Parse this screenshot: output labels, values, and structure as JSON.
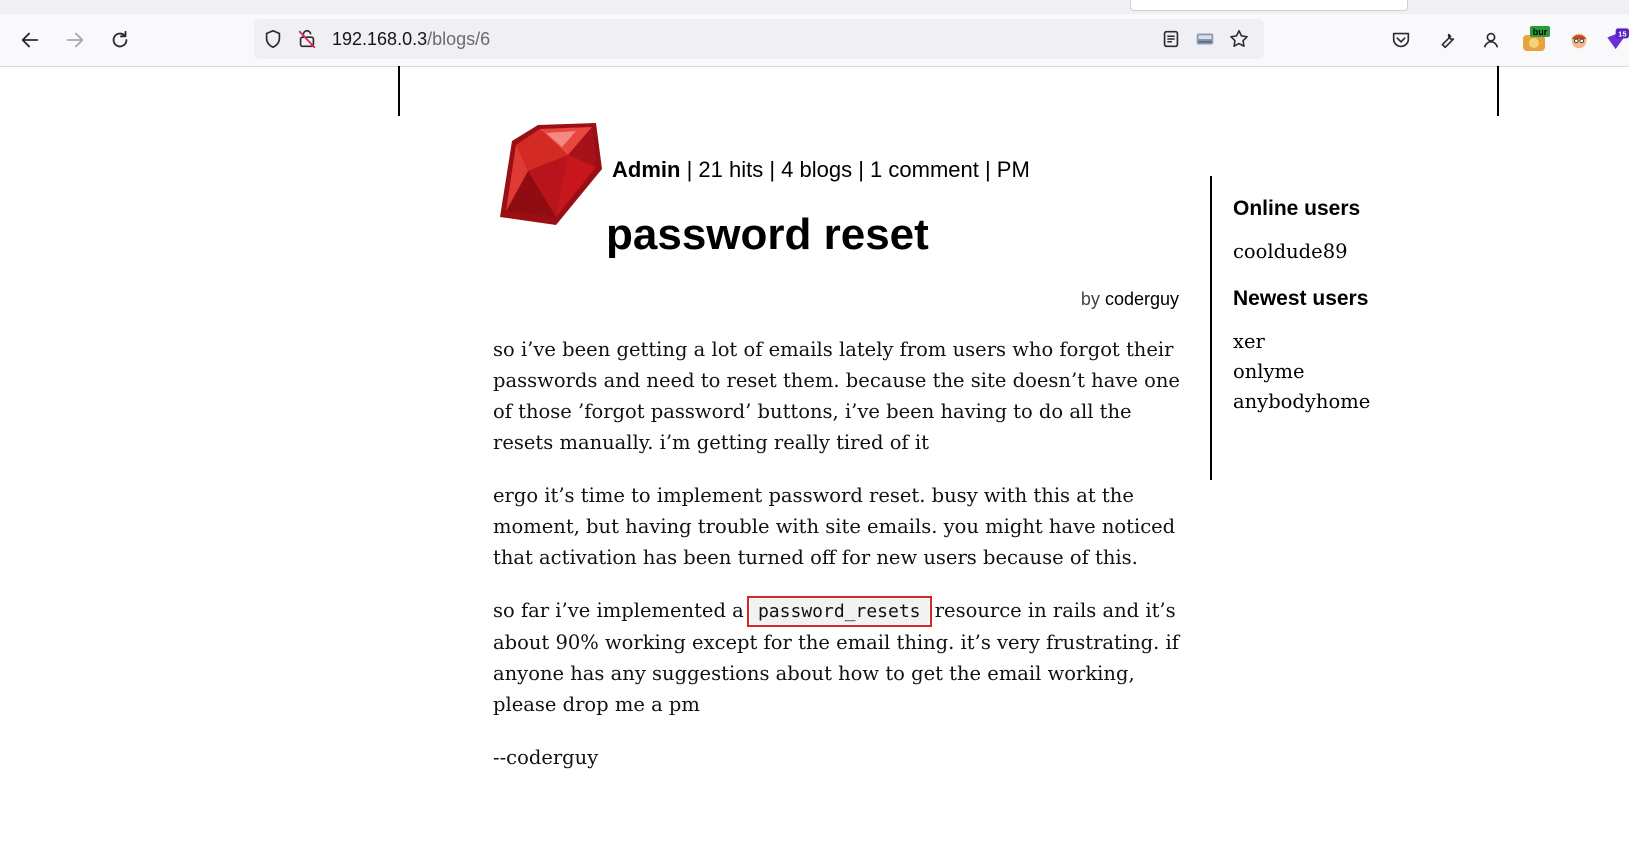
{
  "browser": {
    "url_host": "192.168.0.3",
    "url_path": "/blogs/6",
    "ext_burp_label": "bur",
    "ext_badge_count": "15"
  },
  "post": {
    "meta_user": "Admin",
    "meta_rest": " | 21 hits | 4 blogs | 1 comment | PM",
    "title": "password reset",
    "by_label": "by",
    "author": "coderguy",
    "para1": "so i’ve been getting a lot of emails lately from users who forgot their passwords and need to reset them. because the site doesn’t have one of those ’forgot password’ buttons, i’ve been having to do all the resets manually. i’m getting really tired of it",
    "para2": "ergo it’s time to implement password reset. busy with this at the moment, but having trouble with site emails. you might have noticed that activation has been turned off for new users because of this.",
    "para3_before": "so far i’ve implemented a ",
    "para3_code": "password_resets",
    "para3_after": " resource in rails and it’s about 90% working except for the email thing. it’s very frustrating. if anyone has any suggestions about how to get the email working, please drop me a pm",
    "signature": "--coderguy"
  },
  "sidebar": {
    "online_title": "Online users",
    "online_users": [
      "cooldude89"
    ],
    "newest_title": "Newest users",
    "newest_users": [
      "xer",
      "onlyme",
      "anybodyhome"
    ]
  },
  "colors": {
    "highlight_border": "#d62828",
    "ruby_red": "#c8161d"
  }
}
